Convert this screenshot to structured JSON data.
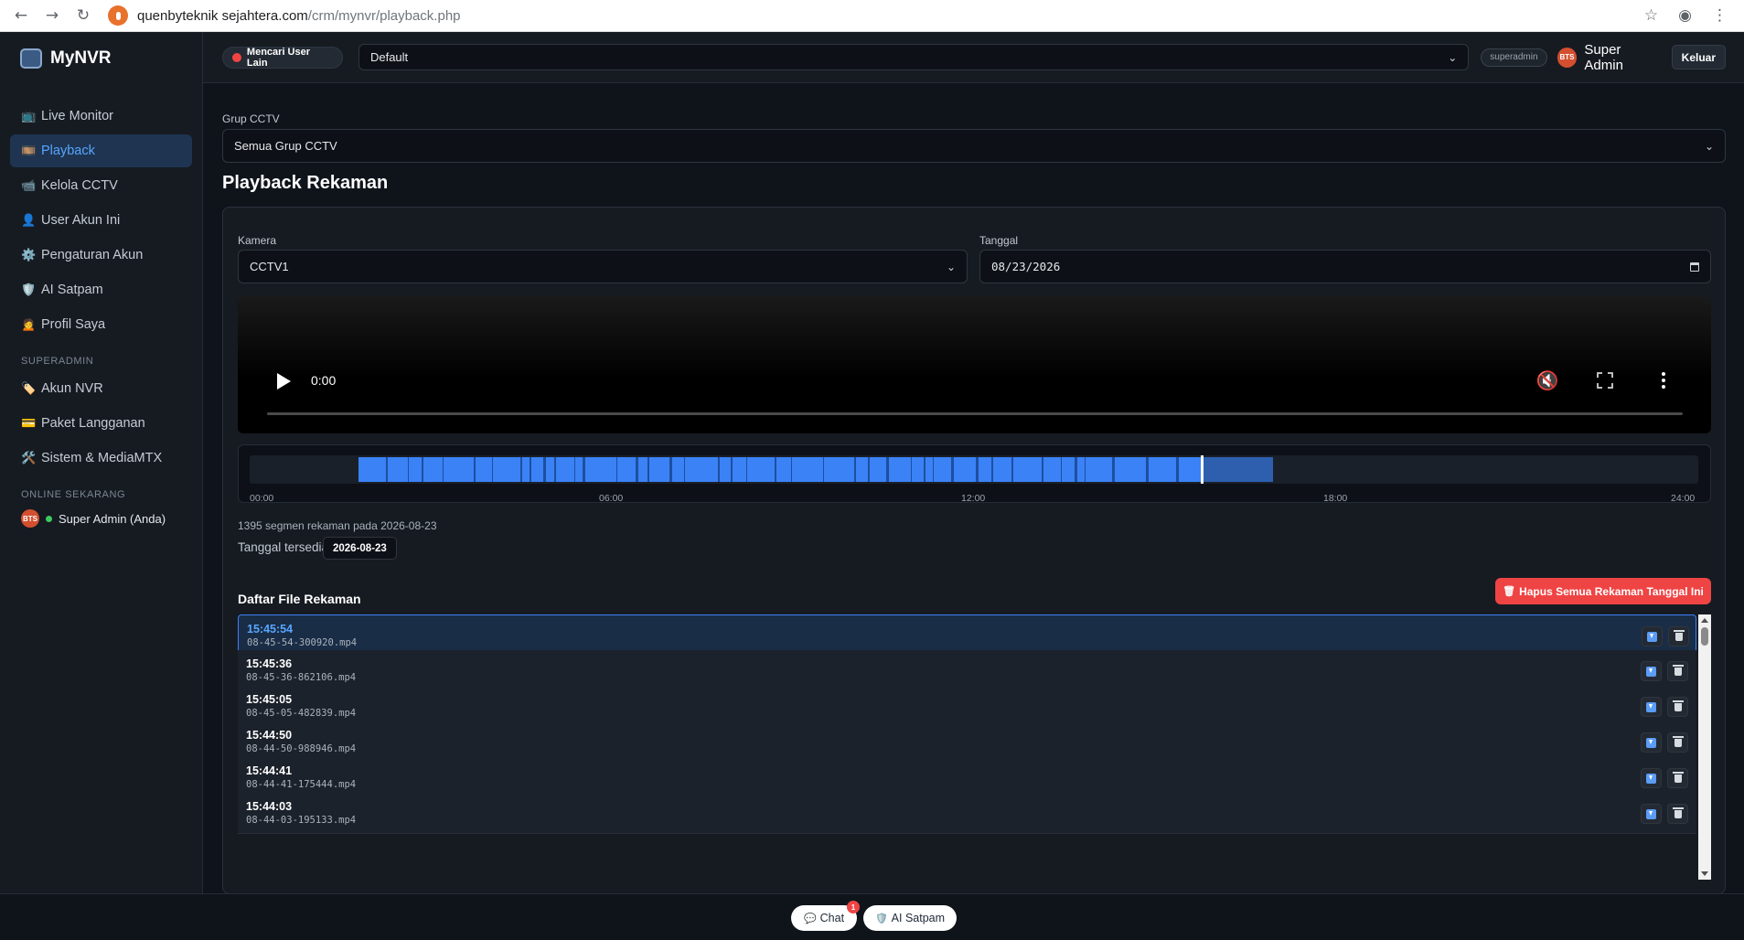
{
  "browser": {
    "url_host": "quenbyteknik sejahtera.com",
    "url_host_exact": "quenbyteknik sejahtera.com",
    "url_display_host": "quenbyteknik sejahtera.com",
    "url_full_host": "quenbyteknik sejahtera.com",
    "url_domain": "quenbyteknik sejahtera.com",
    "url_path": "/crm/mynvr/playback.php"
  },
  "url_text": {
    "host": "quenbyteknik sejahtera.com"
  },
  "sidebar": {
    "brand": "MyNVR",
    "items": [
      {
        "icon": "📺",
        "label": "Live Monitor"
      },
      {
        "icon": "🎞️",
        "label": "Playback"
      },
      {
        "icon": "📹",
        "label": "Kelola CCTV"
      },
      {
        "icon": "👤",
        "label": "User Akun Ini"
      },
      {
        "icon": "⚙️",
        "label": "Pengaturan Akun"
      },
      {
        "icon": "🛡️",
        "label": "AI Satpam"
      },
      {
        "icon": "🙍",
        "label": "Profil Saya"
      }
    ],
    "superadmin_label": "SUPERADMIN",
    "superadmin_items": [
      {
        "icon": "🏷️",
        "label": "Akun NVR"
      },
      {
        "icon": "💳",
        "label": "Paket Langganan"
      },
      {
        "icon": "🛠️",
        "label": "Sistem & MediaMTX"
      }
    ],
    "online_label": "ONLINE SEKARANG",
    "online_user": "Super Admin (Anda)"
  },
  "topbar": {
    "searching_label": "Mencari User Lain",
    "profile_select": "Default",
    "role_badge": "superadmin",
    "avatar_text": "BTS",
    "user_name": "Super Admin",
    "logout_label": "Keluar"
  },
  "main": {
    "group_label": "Grup CCTV",
    "group_value": "Semua Grup CCTV",
    "page_title": "Playback Rekaman",
    "camera_label": "Kamera",
    "camera_value": "CCTV1",
    "date_label": "Tanggal",
    "date_value": "08/23/2026",
    "video_time": "0:00",
    "timeline": {
      "ticks": [
        "00:00",
        "06:00",
        "12:00",
        "18:00",
        "24:00"
      ],
      "recording_start_hour": 1.8,
      "recording_end_hour": 16.95,
      "cursor_hour": 15.76
    },
    "segment_summary": "1395 segmen rekaman pada 2026-08-23",
    "available_label": "Tanggal tersedia:",
    "available_dates": [
      "2026-08-23"
    ],
    "list_title": "Daftar File Rekaman",
    "delete_all_label": "Hapus Semua Rekaman Tanggal Ini",
    "files": [
      {
        "time": "15:45:54",
        "name": "08-45-54-300920.mp4",
        "active": true
      },
      {
        "time": "15:45:36",
        "name": "08-45-36-862106.mp4",
        "active": false
      },
      {
        "time": "15:45:05",
        "name": "08-45-05-482839.mp4",
        "active": false
      },
      {
        "time": "15:44:50",
        "name": "08-44-50-988946.mp4",
        "active": false
      },
      {
        "time": "15:44:41",
        "name": "08-44-41-175444.mp4",
        "active": false
      },
      {
        "time": "15:44:03",
        "name": "08-44-03-195133.mp4",
        "active": false
      }
    ]
  },
  "bottom": {
    "chat_label": "Chat",
    "chat_badge": "1",
    "satpam_label": "AI Satpam"
  }
}
